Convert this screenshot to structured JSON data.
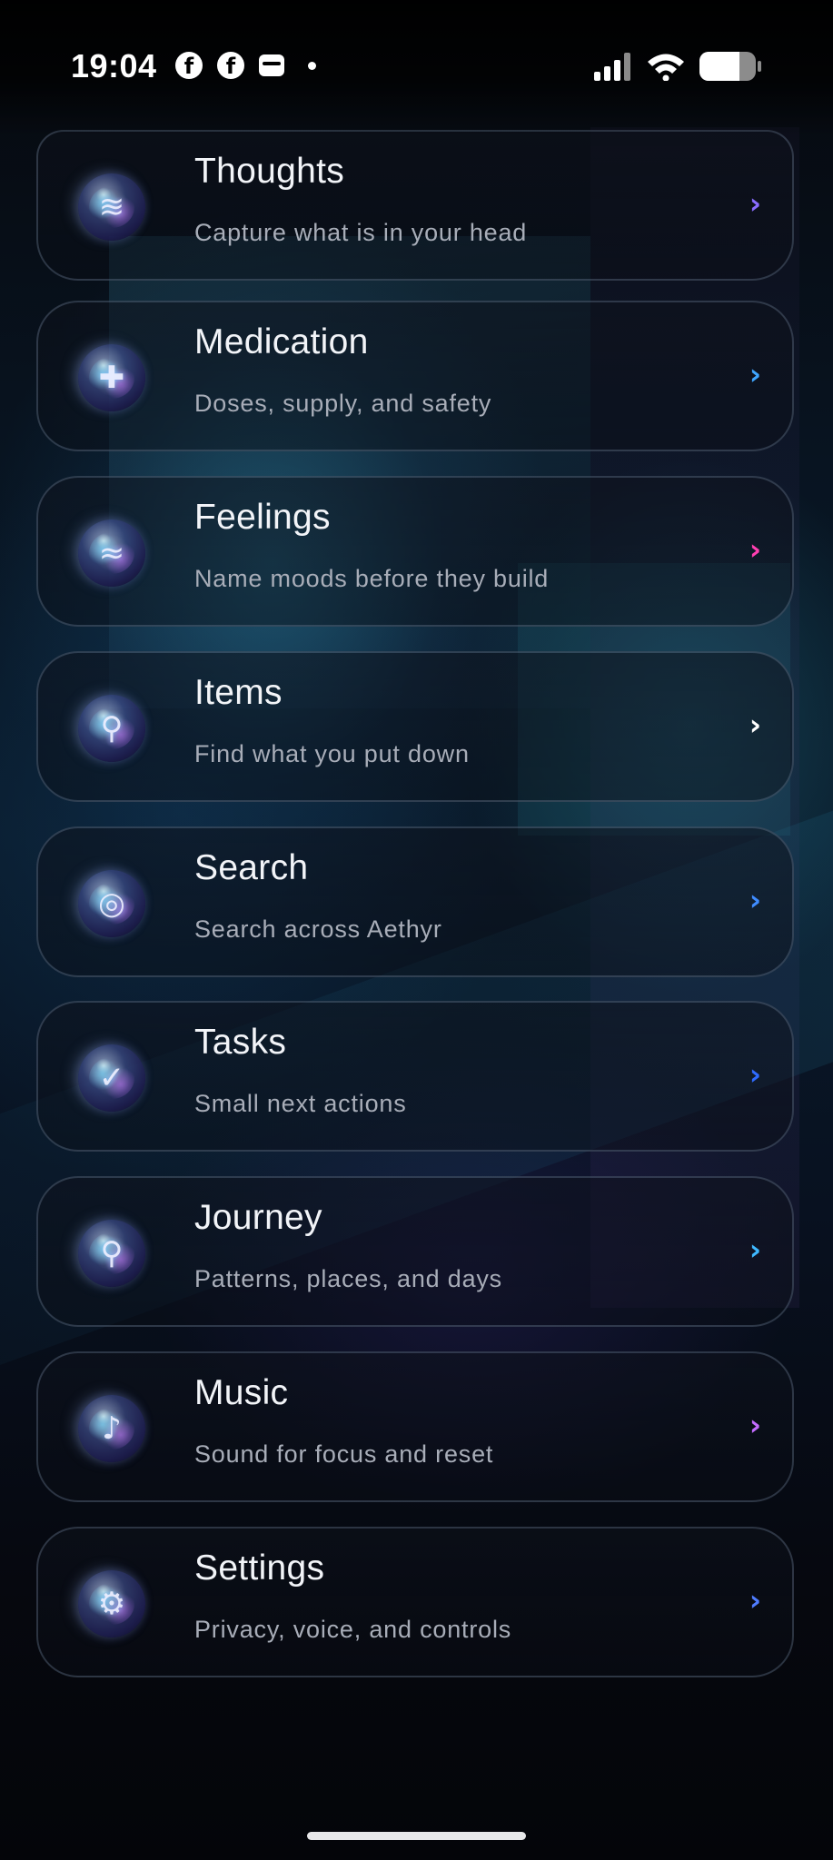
{
  "status_bar": {
    "time": "19:04",
    "left_icons": [
      "facebook-icon",
      "facebook-icon",
      "wallet-icon",
      "dot-icon"
    ],
    "right_icons": [
      "signal-icon",
      "wifi-icon",
      "battery-icon"
    ]
  },
  "menu": {
    "items": [
      {
        "title": "Thoughts",
        "subtitle": "Capture what is in your head",
        "icon": "thoughts-orb-icon",
        "glyph": "≋",
        "chevron_color": "#8a6cff"
      },
      {
        "title": "Medication",
        "subtitle": "Doses, supply, and safety",
        "icon": "medication-orb-icon",
        "glyph": "✚",
        "chevron_color": "#3fa6ff"
      },
      {
        "title": "Feelings",
        "subtitle": "Name moods before they build",
        "icon": "feelings-orb-icon",
        "glyph": "≈",
        "chevron_color": "#ff3fb1"
      },
      {
        "title": "Items",
        "subtitle": "Find what you put down",
        "icon": "items-orb-icon",
        "glyph": "⚲",
        "chevron_color": "#ffffff"
      },
      {
        "title": "Search",
        "subtitle": "Search across Aethyr",
        "icon": "search-orb-icon",
        "glyph": "◎",
        "chevron_color": "#3f8cff"
      },
      {
        "title": "Tasks",
        "subtitle": "Small next actions",
        "icon": "tasks-orb-icon",
        "glyph": "✓",
        "chevron_color": "#2f6bff"
      },
      {
        "title": "Journey",
        "subtitle": "Patterns, places, and days",
        "icon": "journey-orb-icon",
        "glyph": "⚲",
        "chevron_color": "#3fb8ff"
      },
      {
        "title": "Music",
        "subtitle": "Sound for focus and reset",
        "icon": "music-orb-icon",
        "glyph": "♪",
        "chevron_color": "#c46cff"
      },
      {
        "title": "Settings",
        "subtitle": "Privacy, voice, and controls",
        "icon": "settings-orb-icon",
        "glyph": "⚙",
        "chevron_color": "#4f7cff"
      }
    ]
  }
}
